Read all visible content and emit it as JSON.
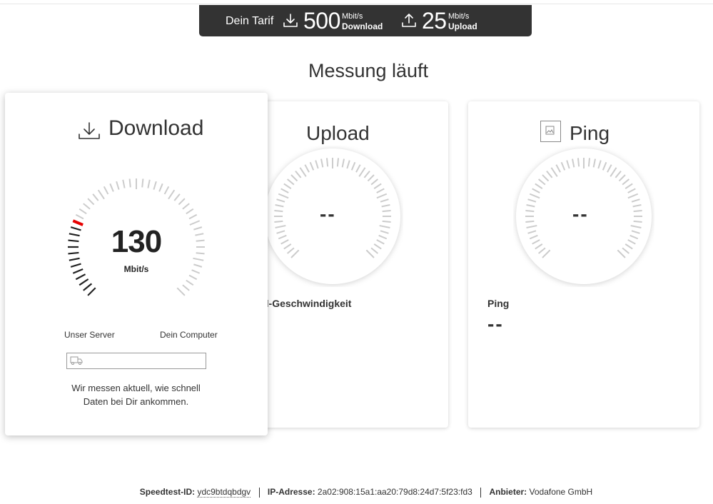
{
  "tariff": {
    "label": "Dein Tarif",
    "download_value": "500",
    "download_unit": "Mbit/s",
    "download_kind": "Download",
    "upload_value": "25",
    "upload_unit": "Mbit/s",
    "upload_kind": "Upload"
  },
  "status_heading": "Messung läuft",
  "download_card": {
    "title": "Download",
    "value": "130",
    "unit": "Mbit/s",
    "server_label": "Unser Server",
    "computer_label": "Dein Computer",
    "note_line1": "Wir messen aktuell, wie schnell",
    "note_line2": "Daten bei Dir ankommen.",
    "progress": 0
  },
  "upload_card": {
    "title": "Upload",
    "value": "--",
    "sublabel": "d-Geschwindigkeit"
  },
  "ping_card": {
    "title": "Ping",
    "value": "--",
    "sublabel": "Ping",
    "result": "--"
  },
  "footer": {
    "speedtest_key": "Speedtest-ID:",
    "speedtest_value": "ydc9btdqbdgv",
    "ip_key": "IP-Adresse:",
    "ip_value": "2a02:908:15a1:aa20:79d8:24d7:5f23:fd3",
    "provider_key": "Anbieter:",
    "provider_value": "Vodafone GmbH"
  },
  "colors": {
    "accent": "#e60000",
    "banner": "#333333",
    "tick": "#cccccc",
    "tick_active": "#222222"
  },
  "icons": {
    "download": "download-arrow-icon",
    "upload": "upload-arrow-icon",
    "ping": "broken-image-icon",
    "transfer": "transfer-truck-icon"
  }
}
